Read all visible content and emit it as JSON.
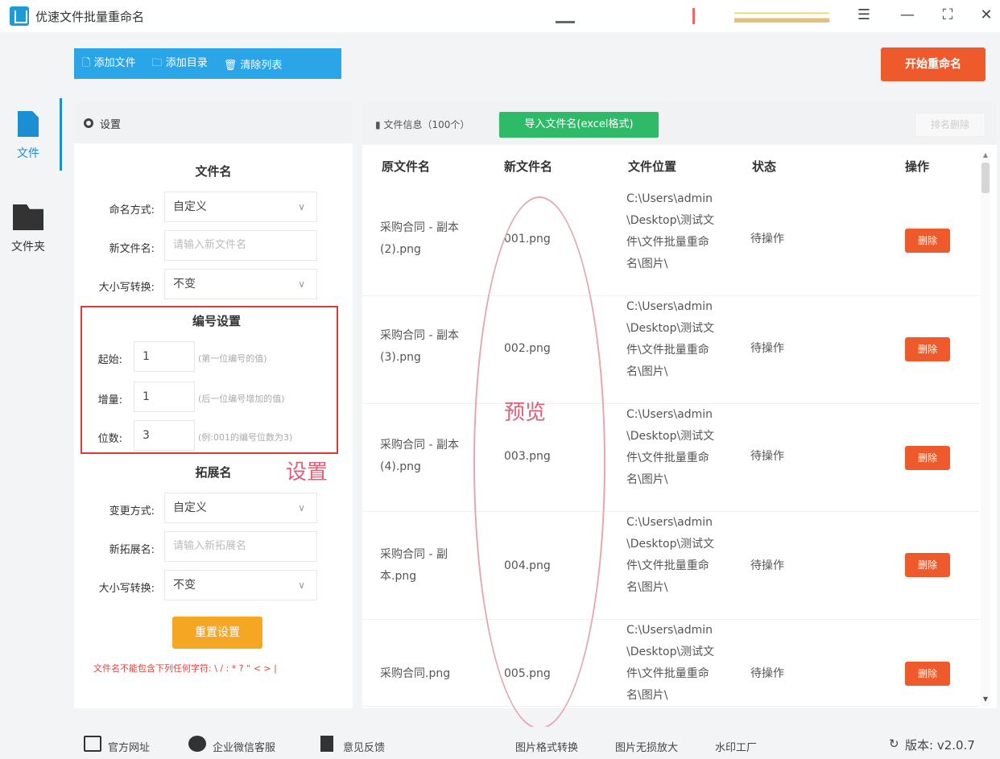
{
  "app": {
    "title": "优速文件批量重命名"
  },
  "sidebar": {
    "items": [
      {
        "label": "文件",
        "icon": "file-icon",
        "active": true
      },
      {
        "label": "文件夹",
        "icon": "folder-icon",
        "active": false
      }
    ]
  },
  "toolbar": {
    "add_file": "🗋 添加文件",
    "add_dir": "🗀 添加目录",
    "clear_list": "🗑 清除列表",
    "start": "开始重命名"
  },
  "settings": {
    "header": "设置",
    "filename_section": "文件名",
    "naming_mode_label": "命名方式:",
    "naming_mode_value": "自定义",
    "new_name_label": "新文件名:",
    "new_name_placeholder": "请输入新文件名",
    "case_label": "大小写转换:",
    "case_value": "不变",
    "numbering_section": "编号设置",
    "start_label": "起始:",
    "start_value": "1",
    "start_hint": "(第一位编号的值)",
    "step_label": "增量:",
    "step_value": "1",
    "step_hint": "(后一位编号增加的值)",
    "digits_label": "位数:",
    "digits_value": "3",
    "digits_hint": "(例:001的编号位数为3)",
    "ext_section": "拓展名",
    "ext_mode_label": "变更方式:",
    "ext_mode_value": "自定义",
    "new_ext_label": "新拓展名:",
    "new_ext_placeholder": "请输入新拓展名",
    "ext_case_label": "大小写转换:",
    "ext_case_value": "不变",
    "reset": "重置设置",
    "warning": "文件名不能包含下列任何字符: \\ / : * ? \" < > |"
  },
  "annotations": {
    "settings_note": "设置",
    "preview_note": "预览"
  },
  "file_list": {
    "info": "文件信息（100个）",
    "import_btn": "导入文件名(excel格式)",
    "sort_btn": "排名删除",
    "columns": [
      "原文件名",
      "新文件名",
      "文件位置",
      "状态",
      "操作"
    ],
    "rows": [
      {
        "orig": "采购合同 - 副本 (2).png",
        "new": "001.png",
        "path": "C:\\Users\\admin\\Desktop\\测试文件\\文件批量重命名\\图片\\",
        "status": "待操作",
        "action": "删除"
      },
      {
        "orig": "采购合同 - 副本 (3).png",
        "new": "002.png",
        "path": "C:\\Users\\admin\\Desktop\\测试文件\\文件批量重命名\\图片\\",
        "status": "待操作",
        "action": "删除"
      },
      {
        "orig": "采购合同 - 副本 (4).png",
        "new": "003.png",
        "path": "C:\\Users\\admin\\Desktop\\测试文件\\文件批量重命名\\图片\\",
        "status": "待操作",
        "action": "删除"
      },
      {
        "orig": "采购合同 - 副本.png",
        "new": "004.png",
        "path": "C:\\Users\\admin\\Desktop\\测试文件\\文件批量重命名\\图片\\",
        "status": "待操作",
        "action": "删除"
      },
      {
        "orig": "采购合同.png",
        "new": "005.png",
        "path": "C:\\Users\\admin\\Desktop\\测试文件\\文件批量重命名\\图片\\",
        "status": "待操作",
        "action": "删除"
      }
    ]
  },
  "footer": {
    "website": "官方网址",
    "wechat": "企业微信客服",
    "feedback": "意见反馈",
    "img_convert": "图片格式转换",
    "img_enlarge": "图片无损放大",
    "watermark": "水印工厂",
    "version": "版本: v2.0.7"
  },
  "colors": {
    "accent_blue": "#2aa5e8",
    "start_orange": "#ee5a2b",
    "import_green": "#2fba68",
    "reset_orange": "#f5a623",
    "annotation_red": "#d63b3b"
  }
}
